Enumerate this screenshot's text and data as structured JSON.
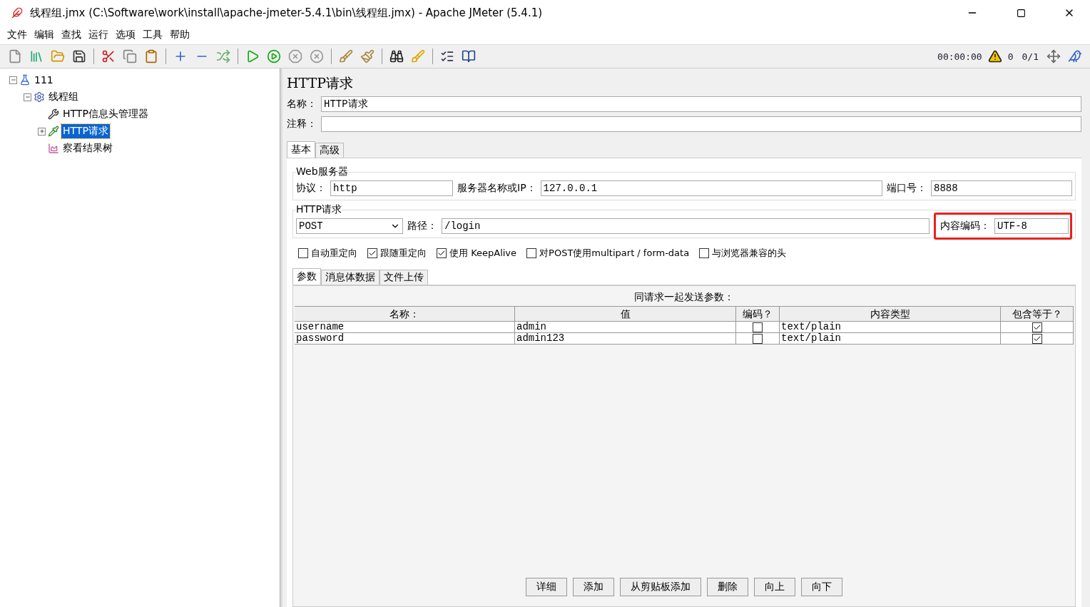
{
  "window": {
    "title": "线程组.jmx (C:\\Software\\work\\install\\apache-jmeter-5.4.1\\bin\\线程组.jmx) - Apache JMeter (5.4.1)"
  },
  "menu": [
    "文件",
    "编辑",
    "查找",
    "运行",
    "选项",
    "工具",
    "帮助"
  ],
  "status": {
    "timer": "00:00:00",
    "warnings": "0",
    "threads": "0/1"
  },
  "tree": [
    {
      "label": "111",
      "kind": "plan",
      "selected": false,
      "expanded": true,
      "children": [
        {
          "label": "线程组",
          "kind": "thread_group",
          "selected": false,
          "expanded": true,
          "children": [
            {
              "label": "HTTP信息头管理器",
              "kind": "config",
              "selected": false
            },
            {
              "label": "HTTP请求",
              "kind": "sampler",
              "selected": true,
              "expanded": false
            },
            {
              "label": "察看结果树",
              "kind": "listener",
              "selected": false
            }
          ]
        }
      ]
    }
  ],
  "panel": {
    "title": "HTTP请求",
    "name_label": "名称：",
    "name_value": "HTTP请求",
    "comment_label": "注释：",
    "tabs": [
      {
        "label": "基本",
        "selected": true
      },
      {
        "label": "高级",
        "selected": false
      }
    ],
    "web_server": {
      "legend": "Web服务器",
      "protocol_label": "协议：",
      "protocol": "http",
      "server_label": "服务器名称或IP：",
      "server": "127.0.0.1",
      "port_label": "端口号：",
      "port": "8888"
    },
    "http_request": {
      "legend": "HTTP请求",
      "method": "POST",
      "path_label": "路径：",
      "path": "/login",
      "encoding_label": "内容编码：",
      "encoding": "UTF-8",
      "highlighted": true
    },
    "options": [
      {
        "label": "自动重定向",
        "checked": false
      },
      {
        "label": "跟随重定向",
        "checked": true
      },
      {
        "label": "使用 KeepAlive",
        "checked": true
      },
      {
        "label": "对POST使用multipart / form-data",
        "checked": false
      },
      {
        "label": "与浏览器兼容的头",
        "checked": false
      }
    ],
    "sub_tabs": [
      {
        "label": "参数",
        "selected": true
      },
      {
        "label": "消息体数据",
        "selected": false
      },
      {
        "label": "文件上传",
        "selected": false
      }
    ],
    "table": {
      "caption": "同请求一起发送参数：",
      "columns": [
        "名称：",
        "值",
        "编码？",
        "内容类型",
        "包含等于？"
      ],
      "rows": [
        {
          "name": "username",
          "value": "admin",
          "encode": false,
          "content_type": "text/plain",
          "include_equals": true
        },
        {
          "name": "password",
          "value": "admin123",
          "encode": false,
          "content_type": "text/plain",
          "include_equals": true
        }
      ]
    },
    "buttons": [
      "详细",
      "添加",
      "从剪贴板添加",
      "删除",
      "向上",
      "向下"
    ]
  }
}
